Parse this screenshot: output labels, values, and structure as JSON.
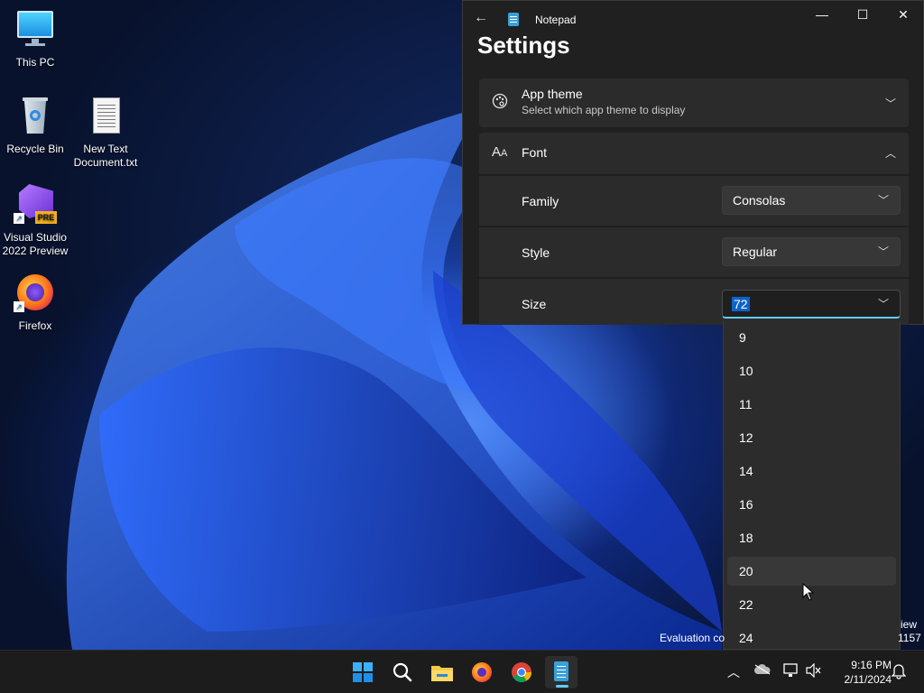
{
  "desktop": {
    "icons": [
      {
        "label": "This PC"
      },
      {
        "label": "Recycle Bin"
      },
      {
        "label": "New Text Document.txt"
      },
      {
        "label": "Visual Studio 2022 Preview",
        "badge": "PRE"
      },
      {
        "label": "Firefox"
      }
    ],
    "watermark_left": "Evaluation co",
    "watermark_right_1": "iew",
    "watermark_right_2": "1157"
  },
  "window": {
    "app_title": "Notepad",
    "page_title": "Settings",
    "app_theme": {
      "label": "App theme",
      "sub": "Select which app theme to display"
    },
    "font": {
      "label": "Font",
      "family_label": "Family",
      "family_value": "Consolas",
      "style_label": "Style",
      "style_value": "Regular",
      "size_label": "Size",
      "size_value": "72"
    }
  },
  "size_dropdown": {
    "options": [
      "9",
      "10",
      "11",
      "12",
      "14",
      "16",
      "18",
      "20",
      "22",
      "24"
    ],
    "hovered": "20"
  },
  "taskbar": {
    "apps": [
      "start",
      "search",
      "file-explorer",
      "firefox",
      "chrome",
      "notepad"
    ],
    "active": "notepad",
    "time": "9:16 PM",
    "date": "2/11/2024"
  },
  "colors": {
    "accent": "#60cdff",
    "selection": "#0e63c9",
    "window_bg": "#202020",
    "card_bg": "#2b2b2b"
  }
}
